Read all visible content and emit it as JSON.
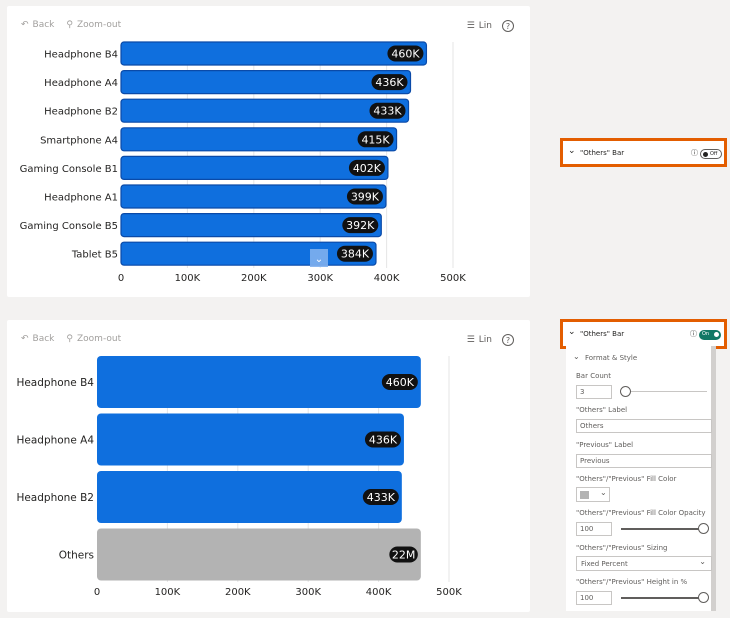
{
  "toolbar": {
    "back_label": "Back",
    "zoomout_label": "Zoom-out",
    "lin_label": "Lin",
    "help": "?"
  },
  "chart_data": [
    {
      "type": "bar",
      "orientation": "horizontal",
      "categories": [
        "Headphone B4",
        "Headphone A4",
        "Headphone B2",
        "Smartphone A4",
        "Gaming Console B1",
        "Headphone A1",
        "Gaming Console B5",
        "Tablet B5"
      ],
      "values": [
        460000,
        436000,
        433000,
        415000,
        402000,
        399000,
        392000,
        384000
      ],
      "data_labels": [
        "460K",
        "436K",
        "433K",
        "415K",
        "402K",
        "399K",
        "392K",
        "384K"
      ],
      "xticks": [
        "0",
        "100K",
        "200K",
        "300K",
        "400K",
        "500K"
      ],
      "xlim": [
        0,
        500000
      ],
      "bar_color": "#0f6fde"
    },
    {
      "type": "bar",
      "orientation": "horizontal",
      "categories": [
        "Headphone B4",
        "Headphone A4",
        "Headphone B2",
        "Others"
      ],
      "values": [
        460000,
        436000,
        433000,
        460000
      ],
      "data_labels": [
        "460K",
        "436K",
        "433K",
        "22M"
      ],
      "xticks": [
        "0",
        "100K",
        "200K",
        "300K",
        "400K",
        "500K"
      ],
      "xlim": [
        0,
        500000
      ],
      "bar_color": "#0f6fde",
      "others_color": "#b3b3b3"
    }
  ],
  "others_panel": {
    "title": "\"Others\" Bar",
    "toggle_off": "Off",
    "toggle_on": "On",
    "section": "Format & Style",
    "bar_count_label": "Bar Count",
    "bar_count_value": "3",
    "others_label_label": "\"Others\" Label",
    "others_label_value": "Others",
    "previous_label_label": "\"Previous\" Label",
    "previous_label_value": "Previous",
    "fill_color_label": "\"Others\"/\"Previous\" Fill Color",
    "fill_opacity_label": "\"Others\"/\"Previous\" Fill Color Opacity",
    "fill_opacity_value": "100",
    "sizing_label": "\"Others\"/\"Previous\" Sizing",
    "sizing_value": "Fixed Percent",
    "height_label": "\"Others\"/\"Previous\" Height in %",
    "height_value": "100"
  }
}
